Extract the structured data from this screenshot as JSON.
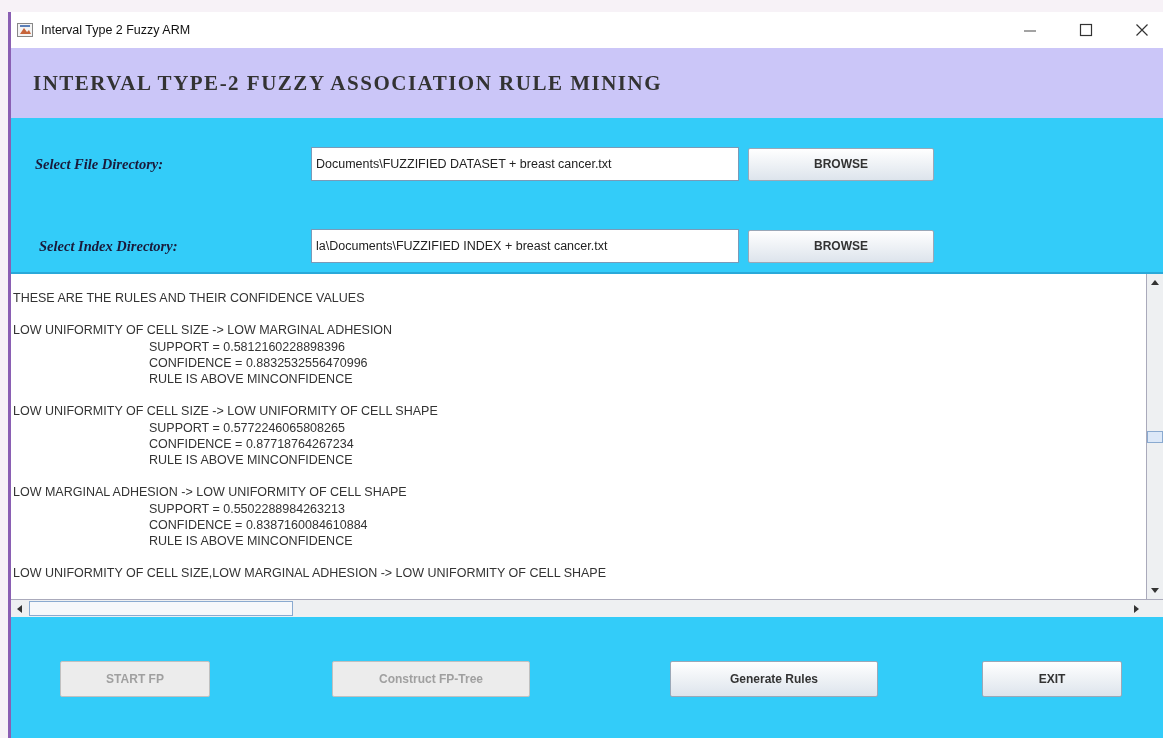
{
  "window": {
    "title": "Interval Type 2 Fuzzy ARM"
  },
  "header": "INTERVAL TYPE-2 FUZZY ASSOCIATION RULE MINING",
  "inputs": [
    {
      "label": "Select File Directory:",
      "value": "Documents\\FUZZIFIED DATASET + breast cancer.txt",
      "button": "BROWSE"
    },
    {
      "label": "Select Index Directory:",
      "value": "la\\Documents\\FUZZIFIED INDEX + breast cancer.txt",
      "button": "BROWSE"
    }
  ],
  "output": {
    "heading": "THESE ARE THE RULES AND THEIR CONFIDENCE VALUES",
    "rules": [
      {
        "rule": "LOW UNIFORMITY OF CELL SIZE -> LOW MARGINAL ADHESION",
        "details": [
          "SUPPORT =    0.5812160228898396",
          "CONFIDENCE =    0.8832532556470996",
          "RULE IS ABOVE MINCONFIDENCE"
        ]
      },
      {
        "rule": "LOW UNIFORMITY OF CELL SIZE -> LOW UNIFORMITY OF CELL SHAPE",
        "details": [
          "SUPPORT =    0.5772246065808265",
          "CONFIDENCE =    0.87718764267234",
          "RULE IS ABOVE MINCONFIDENCE"
        ]
      },
      {
        "rule": "LOW MARGINAL ADHESION -> LOW UNIFORMITY OF CELL SHAPE",
        "details": [
          "SUPPORT =    0.5502288984263213",
          "CONFIDENCE =    0.8387160084610884",
          "RULE IS ABOVE MINCONFIDENCE"
        ]
      },
      {
        "rule": "LOW UNIFORMITY OF CELL SIZE,LOW MARGINAL ADHESION -> LOW UNIFORMITY OF CELL SHAPE"
      }
    ]
  },
  "buttons": [
    {
      "label": "START FP",
      "disabled": true
    },
    {
      "label": "Construct FP-Tree",
      "disabled": true
    },
    {
      "label": "Generate Rules",
      "disabled": false
    },
    {
      "label": "EXIT",
      "disabled": false
    }
  ]
}
